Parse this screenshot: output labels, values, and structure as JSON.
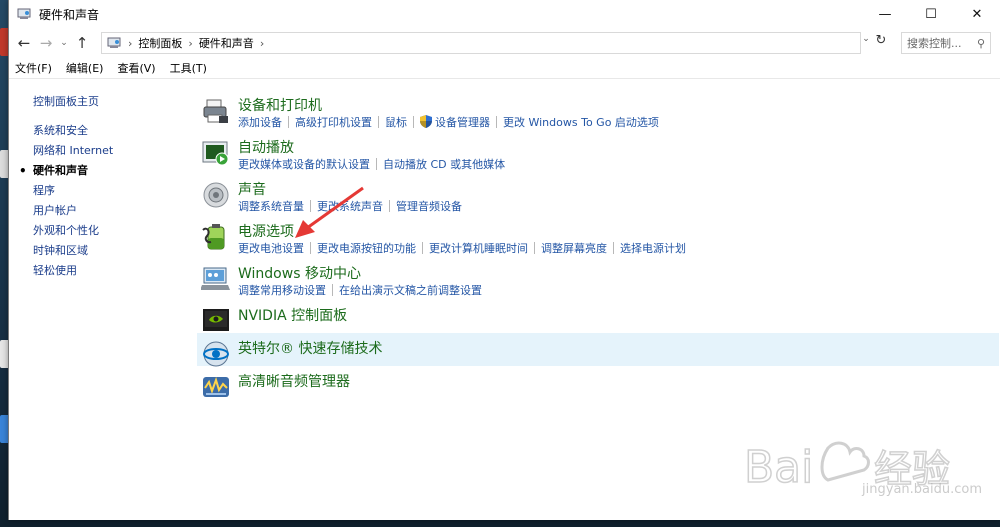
{
  "window": {
    "title": "硬件和声音",
    "controls": {
      "minimize": "—",
      "maximize": "☐",
      "close": "✕"
    }
  },
  "address_bar": {
    "back": "←",
    "forward": "→",
    "history": "⌄",
    "up": "↑",
    "crumbs": [
      "控制面板",
      "硬件和声音"
    ],
    "separator": "›",
    "dropdown": "⌄",
    "refresh": "↻",
    "search_placeholder": "搜索控制...",
    "search_icon": "⚲"
  },
  "menu": [
    "文件(F)",
    "编辑(E)",
    "查看(V)",
    "工具(T)"
  ],
  "left_nav": {
    "home": "控制面板主页",
    "items": [
      "系统和安全",
      "网络和 Internet",
      "硬件和声音",
      "程序",
      "用户帐户",
      "外观和个性化",
      "时钟和区域",
      "轻松使用"
    ],
    "current_index": 2,
    "bullet": "•"
  },
  "sections": [
    {
      "title": "设备和打印机",
      "icon": "printer-icon",
      "links": [
        "添加设备",
        "高级打印机设置",
        "鼠标",
        "设备管理器",
        "更改 Windows To Go 启动选项"
      ]
    },
    {
      "title": "自动播放",
      "icon": "autoplay-icon",
      "links": [
        "更改媒体或设备的默认设置",
        "自动播放 CD 或其他媒体"
      ]
    },
    {
      "title": "声音",
      "icon": "speaker-icon",
      "links": [
        "调整系统音量",
        "更改系统声音",
        "管理音频设备"
      ]
    },
    {
      "title": "电源选项",
      "icon": "battery-icon",
      "links": [
        "更改电池设置",
        "更改电源按钮的功能",
        "更改计算机睡眠时间",
        "调整屏幕亮度",
        "选择电源计划"
      ]
    },
    {
      "title": "Windows 移动中心",
      "icon": "mobility-center-icon",
      "links": [
        "调整常用移动设置",
        "在给出演示文稿之前调整设置"
      ]
    },
    {
      "title": "NVIDIA 控制面板",
      "icon": "nvidia-icon",
      "links": []
    },
    {
      "title": "英特尔® 快速存储技术",
      "icon": "intel-rst-icon",
      "links": []
    },
    {
      "title": "高清晰音频管理器",
      "icon": "audio-manager-icon",
      "links": []
    }
  ],
  "watermark": {
    "logo": "Bai 经验",
    "url": "jingyan.baidu.com"
  },
  "colors": {
    "link": "#2456a5",
    "section_title": "#1c6b1c",
    "highlight": "#e5f3fb",
    "annotation_arrow": "#e53935"
  }
}
